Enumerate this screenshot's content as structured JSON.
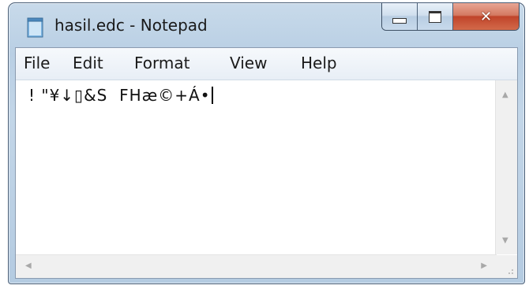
{
  "window": {
    "title": "hasil.edc - Notepad",
    "close_glyph": "✕"
  },
  "menu": {
    "items": [
      "File",
      "Edit",
      "Format",
      "View",
      "Help"
    ]
  },
  "editor": {
    "content": "! \"¥↓▯&S  FHæ©+Á•"
  },
  "icons": {
    "app": "notepad-icon",
    "minimize": "minimize-icon",
    "maximize": "maximize-icon",
    "close": "close-icon",
    "scroll_up": "scroll-up-arrow-icon",
    "scroll_down": "scroll-down-arrow-icon",
    "scroll_left": "scroll-left-arrow-icon",
    "scroll_right": "scroll-right-arrow-icon",
    "size_grip": "size-grip-icon"
  },
  "colors": {
    "frame": "#b9cfe4",
    "close_button": "#c0442a",
    "text": "#111111"
  }
}
